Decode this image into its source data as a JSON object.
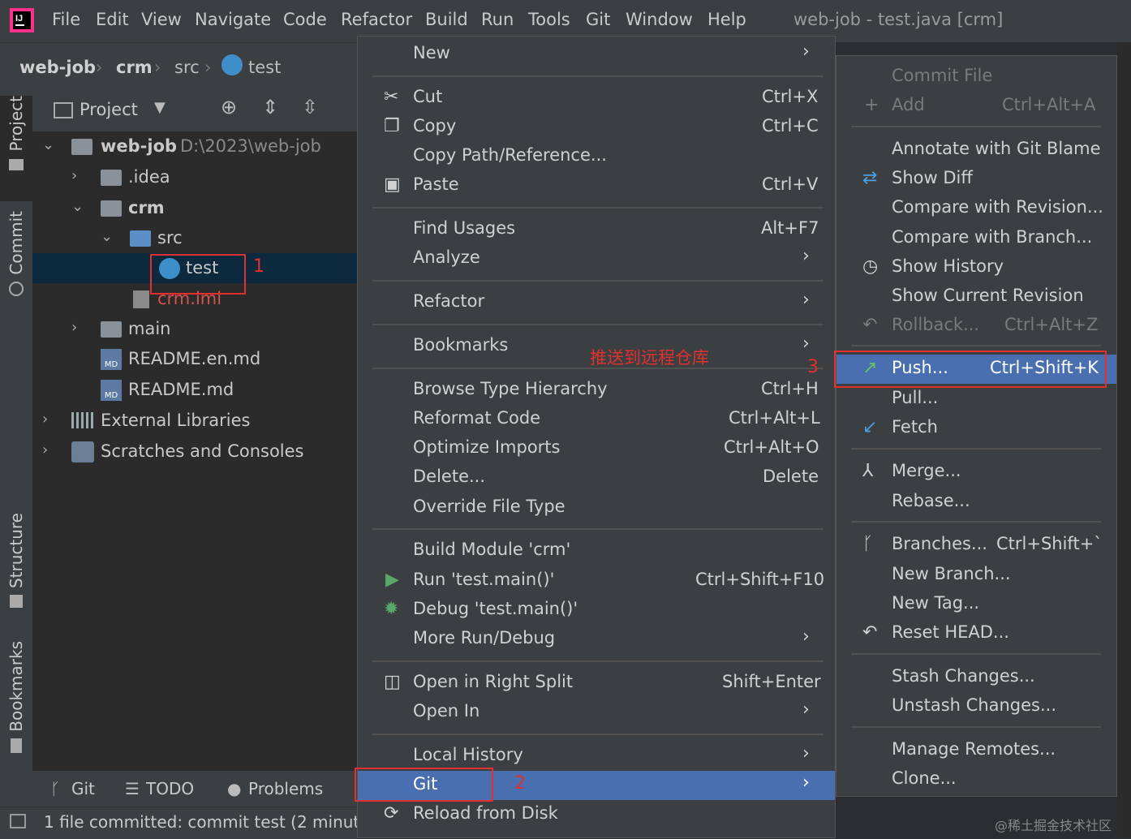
{
  "menubar": {
    "items": [
      "File",
      "Edit",
      "View",
      "Navigate",
      "Code",
      "Refactor",
      "Build",
      "Run",
      "Tools",
      "Git",
      "Window",
      "Help"
    ],
    "window_title": "web-job - test.java [crm]"
  },
  "breadcrumb": [
    "web-job",
    "crm",
    "src",
    "test"
  ],
  "sidebar": {
    "project": "Project",
    "commit": "Commit",
    "structure": "Structure",
    "bookmarks": "Bookmarks"
  },
  "project_panel": {
    "title": "Project"
  },
  "tree": [
    {
      "label": "web-job",
      "extra": "D:\\2023\\web-job"
    },
    {
      "label": ".idea"
    },
    {
      "label": "crm"
    },
    {
      "label": "src"
    },
    {
      "label": "test"
    },
    {
      "label": "crm.iml"
    },
    {
      "label": "main"
    },
    {
      "label": "README.en.md"
    },
    {
      "label": "README.md"
    },
    {
      "label": "External Libraries"
    },
    {
      "label": "Scratches and Consoles"
    }
  ],
  "bottom_tabs": [
    "Git",
    "TODO",
    "Problems"
  ],
  "status": "1 file committed: commit test (2 minut",
  "context_menu": [
    {
      "label": "New",
      "submenu": true
    },
    {
      "label": "Cut",
      "shortcut": "Ctrl+X"
    },
    {
      "label": "Copy",
      "shortcut": "Ctrl+C"
    },
    {
      "label": "Copy Path/Reference..."
    },
    {
      "label": "Paste",
      "shortcut": "Ctrl+V"
    },
    {
      "label": "Find Usages",
      "shortcut": "Alt+F7"
    },
    {
      "label": "Analyze",
      "submenu": true
    },
    {
      "label": "Refactor",
      "submenu": true
    },
    {
      "label": "Bookmarks",
      "submenu": true
    },
    {
      "label": "Browse Type Hierarchy",
      "shortcut": "Ctrl+H"
    },
    {
      "label": "Reformat Code",
      "shortcut": "Ctrl+Alt+L"
    },
    {
      "label": "Optimize Imports",
      "shortcut": "Ctrl+Alt+O"
    },
    {
      "label": "Delete...",
      "shortcut": "Delete"
    },
    {
      "label": "Override File Type"
    },
    {
      "label": "Build Module 'crm'"
    },
    {
      "label": "Run 'test.main()'",
      "shortcut": "Ctrl+Shift+F10"
    },
    {
      "label": "Debug 'test.main()'"
    },
    {
      "label": "More Run/Debug",
      "submenu": true
    },
    {
      "label": "Open in Right Split",
      "shortcut": "Shift+Enter"
    },
    {
      "label": "Open In",
      "submenu": true
    },
    {
      "label": "Local History",
      "submenu": true
    },
    {
      "label": "Git",
      "submenu": true
    },
    {
      "label": "Reload from Disk"
    }
  ],
  "git_submenu": [
    {
      "label": "Commit File"
    },
    {
      "label": "Add",
      "shortcut": "Ctrl+Alt+A"
    },
    {
      "label": "Annotate with Git Blame"
    },
    {
      "label": "Show Diff"
    },
    {
      "label": "Compare with Revision..."
    },
    {
      "label": "Compare with Branch..."
    },
    {
      "label": "Show History"
    },
    {
      "label": "Show Current Revision"
    },
    {
      "label": "Rollback...",
      "shortcut": "Ctrl+Alt+Z"
    },
    {
      "label": "Push...",
      "shortcut": "Ctrl+Shift+K"
    },
    {
      "label": "Pull..."
    },
    {
      "label": "Fetch"
    },
    {
      "label": "Merge..."
    },
    {
      "label": "Rebase..."
    },
    {
      "label": "Branches...",
      "shortcut": "Ctrl+Shift+`"
    },
    {
      "label": "New Branch..."
    },
    {
      "label": "New Tag..."
    },
    {
      "label": "Reset HEAD..."
    },
    {
      "label": "Stash Changes..."
    },
    {
      "label": "Unstash Changes..."
    },
    {
      "label": "Manage Remotes..."
    },
    {
      "label": "Clone..."
    }
  ],
  "annotations": {
    "n1": "1",
    "n2": "2",
    "n3": "3",
    "push_note": "推送到远程仓库"
  },
  "watermark": "@稀土掘金技术社区",
  "colors": {
    "highlight": "#4a6fb0",
    "annotation": "#e03030",
    "menu_bg": "#3c3f41"
  }
}
